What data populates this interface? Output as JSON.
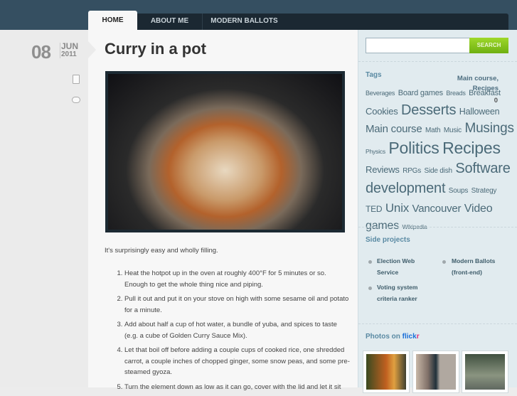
{
  "nav": {
    "tabs": [
      "HOME",
      "ABOUT ME",
      "MODERN BALLOTS"
    ]
  },
  "post": {
    "day": "08",
    "month": "JUN",
    "year": "2011",
    "categories": [
      "Main course,",
      "Recipes"
    ],
    "comment_count": "0",
    "title": "Curry in a pot",
    "intro": "It's surprisingly easy and wholly filling.",
    "steps": [
      "Heat the hotpot up in the oven at roughly 400°F for 5 minutes or so. Enough to get the whole thing nice and piping.",
      "Pull it out and put it on your stove on high with some sesame oil and potato for a minute.",
      "Add about half a cup of hot water, a bundle of yuba, and spices to taste (e.g. a cube of Golden Curry Sauce Mix).",
      "Let that boil off before adding a couple cups of cooked rice, one shredded carrot, a couple inches of chopped ginger, some snow peas, and some pre-steamed gyoza.",
      "Turn the element down as low as it can go, cover with the lid and let it sit"
    ]
  },
  "sidebar": {
    "search_placeholder": "",
    "search_button": "SEARCH",
    "tags_title": "Tags",
    "tags": [
      [
        "Beverages",
        9
      ],
      [
        "Board games",
        11
      ],
      [
        "Breads",
        9
      ],
      [
        "Breakfast",
        11
      ],
      [
        "Cookies",
        13
      ],
      [
        "Desserts",
        20
      ],
      [
        "Halloween",
        12.5
      ],
      [
        "Main course",
        15
      ],
      [
        "Math",
        10
      ],
      [
        "Music",
        10
      ],
      [
        "Musings",
        19
      ],
      [
        "Physics",
        8.5
      ],
      [
        "Politics",
        23
      ],
      [
        "Recipes",
        23
      ],
      [
        "Reviews",
        13
      ],
      [
        "RPGs",
        10
      ],
      [
        "Side dish",
        10
      ],
      [
        "Software",
        20
      ],
      [
        "development",
        20
      ],
      [
        "Soups",
        10
      ],
      [
        "Strategy",
        10
      ],
      [
        "TED",
        12
      ],
      [
        "Unix",
        17
      ],
      [
        "Vancouver",
        15
      ],
      [
        "Video games",
        16
      ],
      [
        "Wikipedia",
        8.5
      ]
    ],
    "projects_title": "Side projects",
    "projects": [
      "Election Web Service",
      "Modern Ballots (front-end)",
      "Voting system criteria ranker"
    ],
    "photos_title": "Photos on",
    "flickr_a": "flick",
    "flickr_b": "r"
  },
  "colors": {
    "accent": "#5a8aa3",
    "search": "#8cc41f",
    "header": "#354f61"
  }
}
